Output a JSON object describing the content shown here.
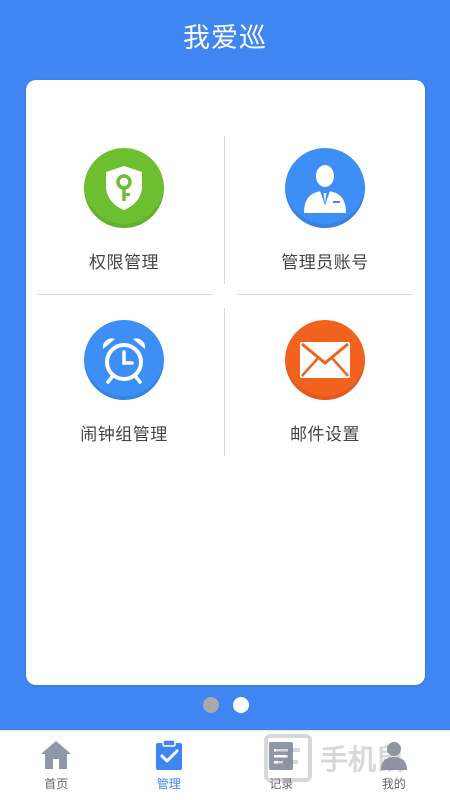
{
  "header": {
    "title": "我爱巡"
  },
  "grid": {
    "items": [
      {
        "label": "权限管理",
        "icon": "key-shield-icon",
        "color": "#6cbf2f"
      },
      {
        "label": "管理员账号",
        "icon": "administrator-icon",
        "color": "#3d8ef5"
      },
      {
        "label": "闹钟组管理",
        "icon": "alarm-clock-icon",
        "color": "#3d8ef5"
      },
      {
        "label": "邮件设置",
        "icon": "envelope-icon",
        "color": "#f2621f"
      }
    ]
  },
  "pager": {
    "total": 2,
    "active_index": 1,
    "inactive_color": "#a9a9a9",
    "active_color": "#ffffff"
  },
  "tabbar": {
    "items": [
      {
        "label": "首页",
        "icon": "home-icon",
        "active": false
      },
      {
        "label": "管理",
        "icon": "clipboard-check-icon",
        "active": true
      },
      {
        "label": "记录",
        "icon": "record-icon",
        "active": false
      },
      {
        "label": "我的",
        "icon": "profile-icon",
        "active": false
      }
    ]
  },
  "watermark": {
    "text": "手机鼠",
    "icon": "watermark-logo-icon"
  },
  "colors": {
    "primary": "#3f86f2",
    "background": "#3f86f2",
    "card": "#ffffff"
  }
}
